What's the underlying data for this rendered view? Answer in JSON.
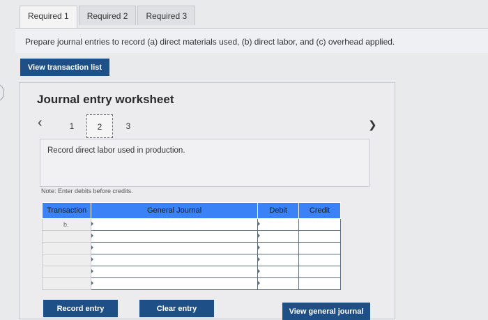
{
  "tabs": [
    {
      "label": "Required 1",
      "active": true
    },
    {
      "label": "Required 2",
      "active": false
    },
    {
      "label": "Required 3",
      "active": false
    }
  ],
  "instruction": "Prepare journal entries to record (a) direct materials used, (b) direct labor, and (c) overhead applied.",
  "view_transaction_list_label": "View transaction list",
  "worksheet": {
    "title": "Journal entry worksheet",
    "prev_icon": "chevron-left-icon",
    "next_icon": "chevron-right-icon",
    "steps": [
      "1",
      "2",
      "3"
    ],
    "current_step": "2",
    "description": "Record direct labor used in production.",
    "note": "Note: Enter debits before credits."
  },
  "table": {
    "headers": {
      "transaction": "Transaction",
      "general_journal": "General Journal",
      "debit": "Debit",
      "credit": "Credit"
    },
    "rows": [
      {
        "transaction": "b.",
        "account": "",
        "debit": "",
        "credit": ""
      },
      {
        "transaction": "",
        "account": "",
        "debit": "",
        "credit": ""
      },
      {
        "transaction": "",
        "account": "",
        "debit": "",
        "credit": ""
      },
      {
        "transaction": "",
        "account": "",
        "debit": "",
        "credit": ""
      },
      {
        "transaction": "",
        "account": "",
        "debit": "",
        "credit": ""
      },
      {
        "transaction": "",
        "account": "",
        "debit": "",
        "credit": ""
      }
    ]
  },
  "buttons": {
    "record_entry": "Record entry",
    "clear_entry": "Clear entry",
    "view_general_journal": "View general journal"
  },
  "colors": {
    "primary_button": "#1f4f87",
    "table_header": "#3b82f6"
  }
}
